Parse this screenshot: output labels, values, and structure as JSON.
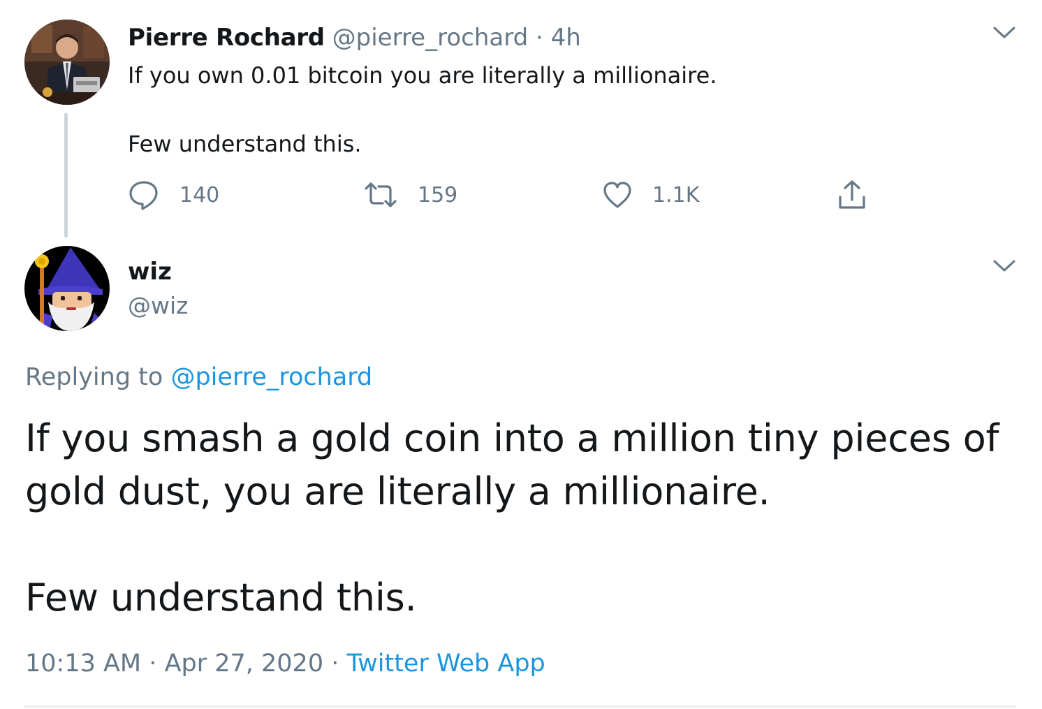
{
  "parent_tweet": {
    "name": "Pierre Rochard",
    "handle": "@pierre_rochard",
    "separator": "·",
    "time": "4h",
    "text_line1": "If you own 0.01 bitcoin you are literally a millionaire.",
    "text_line2": "Few understand this.",
    "reply_count": "140",
    "retweet_count": "159",
    "like_count": "1.1K",
    "avatar_icon": "pierre-avatar"
  },
  "main_tweet": {
    "name": "wiz",
    "handle": "@wiz",
    "replying_prefix": "Replying to",
    "replying_handle": "@pierre_rochard",
    "text_line1": "If you smash a gold coin into a million tiny pieces of gold dust, you are literally a millionaire.",
    "text_line2": "Few understand this.",
    "time": "10:13 AM",
    "date": "Apr 27, 2020",
    "sep1": "·",
    "sep2": "·",
    "source": "Twitter Web App",
    "avatar_icon": "wizard-avatar"
  },
  "icons": {
    "reply": "reply-icon",
    "retweet": "retweet-icon",
    "like": "heart-icon",
    "share": "share-icon",
    "more": "chevron-down-icon"
  },
  "colors": {
    "text": "#14171a",
    "muted": "#657786",
    "link": "#1b95e0",
    "thread_line": "#ccd6dd",
    "divider": "#e6ecf0"
  }
}
